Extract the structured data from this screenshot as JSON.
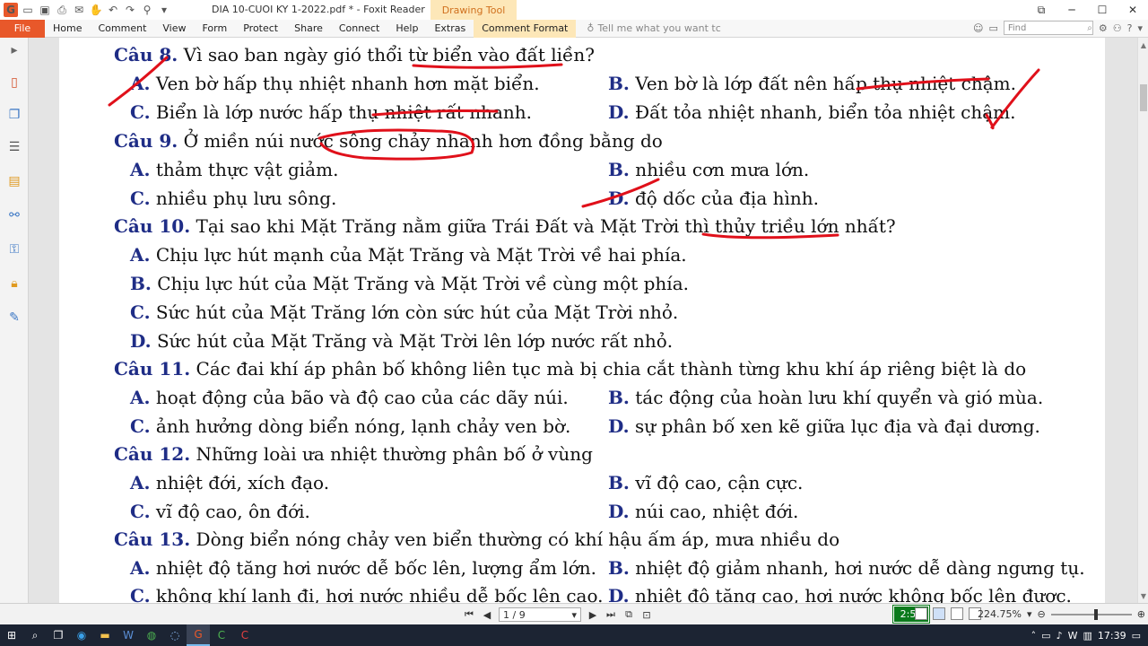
{
  "window": {
    "title": "DIA 10-CUOI KY 1-2022.pdf * - Foxit Reader",
    "contextual_tab": "Drawing Tool"
  },
  "menu": {
    "file": "File",
    "items": [
      "Home",
      "Comment",
      "View",
      "Form",
      "Protect",
      "Share",
      "Connect",
      "Help",
      "Extras",
      "Comment Format"
    ],
    "tell_me": "Tell me what you want tc",
    "find_placeholder": "Find"
  },
  "document": {
    "lines": [
      {
        "label": "Câu 8.",
        "text": "Vì sao ban ngày gió thổi từ biển vào đất liền?"
      },
      {
        "label": "A.",
        "text": "Ven bờ hấp thụ nhiệt nhanh hơn mặt biển."
      },
      {
        "label": "B.",
        "text": "Ven bờ là lớp đất nên hấp thụ nhiệt chậm."
      },
      {
        "label": "C.",
        "text": "Biển là lớp nước hấp thụ nhiệt rất nhanh."
      },
      {
        "label": "D.",
        "text": "Đất tỏa nhiệt nhanh, biển tỏa nhiệt chậm."
      },
      {
        "label": "Câu 9.",
        "text": "Ở miền núi nước sông chảy nhanh hơn đồng bằng do"
      },
      {
        "label": "A.",
        "text": "thảm thực vật giảm."
      },
      {
        "label": "B.",
        "text": "nhiều cơn mưa lớn."
      },
      {
        "label": "C.",
        "text": "nhiều phụ lưu sông."
      },
      {
        "label": "D.",
        "text": "độ dốc của địa hình."
      },
      {
        "label": "Câu 10.",
        "text": "Tại sao khi Mặt Trăng nằm giữa Trái Đất và Mặt Trời thì thủy triều lớn nhất?"
      },
      {
        "label": "A.",
        "text": "Chịu lực hút mạnh của Mặt Trăng và Mặt Trời về hai phía."
      },
      {
        "label": "B.",
        "text": "Chịu lực hút của Mặt Trăng và Mặt Trời về cùng một phía."
      },
      {
        "label": "C.",
        "text": "Sức hút của Mặt Trăng lớn còn sức hút của Mặt Trời nhỏ."
      },
      {
        "label": "D.",
        "text": "Sức hút của Mặt Trăng và Mặt Trời lên lớp nước rất nhỏ."
      },
      {
        "label": "Câu 11.",
        "text": "Các đai khí áp phân bố không liên tục mà bị chia cắt thành từng khu khí áp riêng biệt là do"
      },
      {
        "label": "A.",
        "text": "hoạt động của bão và độ cao của các dãy núi."
      },
      {
        "label": "B.",
        "text": "tác động của hoàn lưu khí quyển và gió mùa."
      },
      {
        "label": "C.",
        "text": "ảnh hưởng dòng biển nóng, lạnh chảy ven bờ."
      },
      {
        "label": "D.",
        "text": "sự phân bố xen kẽ giữa lục địa và đại dương."
      },
      {
        "label": "Câu 12.",
        "text": "Những loài ưa nhiệt thường phân bố ở vùng"
      },
      {
        "label": "A.",
        "text": "nhiệt đới, xích đạo."
      },
      {
        "label": "B.",
        "text": "vĩ độ cao, cận cực."
      },
      {
        "label": "C.",
        "text": "vĩ độ cao, ôn đới."
      },
      {
        "label": "D.",
        "text": "núi cao, nhiệt đới."
      },
      {
        "label": "Câu 13.",
        "text": "Dòng biển nóng chảy ven biển thường có khí hậu ấm áp, mưa nhiều do"
      },
      {
        "label": "A.",
        "text": "nhiệt độ tăng hơi nước dễ bốc lên, lượng ẩm lớn."
      },
      {
        "label": "B.",
        "text": "nhiệt độ giảm nhanh, hơi nước dễ dàng ngưng tụ."
      },
      {
        "label": "C.",
        "text": "không khí lạnh đi, hơi nước nhiều dễ bốc lên cao."
      },
      {
        "label": "D.",
        "text": "nhiệt độ tăng cao, hơi nước không bốc lên được."
      }
    ]
  },
  "status": {
    "page_indicator": "1 / 9",
    "zoom": "224.75%",
    "timer": "2:53"
  },
  "taskbar": {
    "clock": "17:39"
  },
  "colors": {
    "accent": "#e8582a",
    "question_label": "#1f2d86",
    "annotation": "#e0101a"
  }
}
